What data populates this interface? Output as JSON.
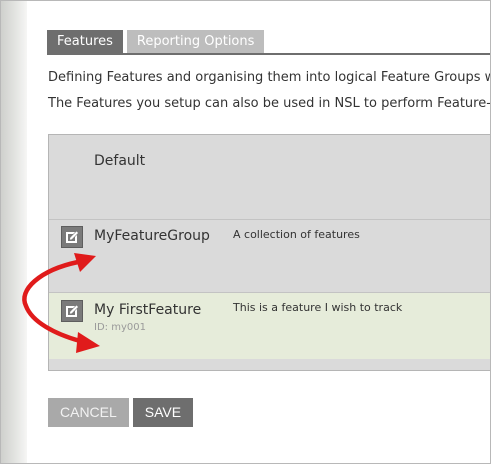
{
  "tabs": [
    {
      "label": "Features",
      "active": true
    },
    {
      "label": "Reporting Options",
      "active": false
    }
  ],
  "description": {
    "line1": "Defining Features and organising them into logical Feature Groups will",
    "line2": "The Features you setup can also be used in NSL to perform Feature-leve"
  },
  "table": {
    "default_group": {
      "title": "Default"
    },
    "rows": [
      {
        "name": "MyFeatureGroup",
        "id": "",
        "description": "A collection of features",
        "icon": "edit-icon"
      },
      {
        "name": "My FirstFeature",
        "id": "ID: my001",
        "description": "This is a feature I wish to track",
        "icon": "edit-icon"
      }
    ]
  },
  "buttons": {
    "cancel_label": "CANCEL",
    "save_label": "SAVE"
  },
  "annotation": {
    "color": "#e01b1b",
    "icon": "curved-double-arrow"
  },
  "colors": {
    "tab_active": "#6e6e6e",
    "tab_inactive": "#bdbdbd",
    "feature_row_bg": "#e6ecda",
    "table_bg": "#dadada"
  }
}
